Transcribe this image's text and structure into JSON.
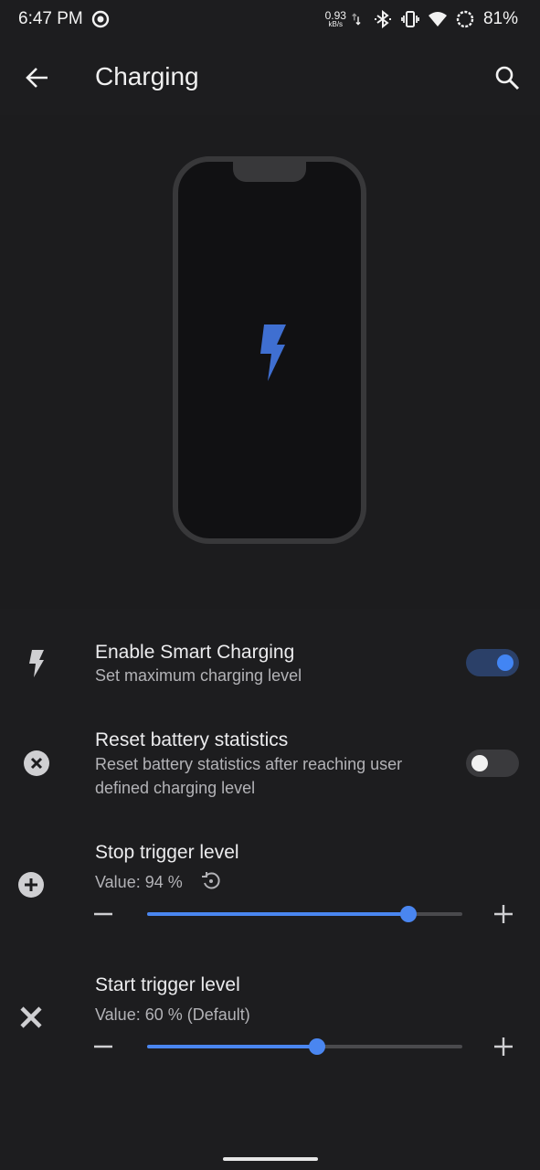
{
  "status_bar": {
    "time": "6:47 PM",
    "net_speed_value": "0.93",
    "net_speed_unit": "kB/s",
    "battery_percent": "81%",
    "icons": [
      "screen-record-icon",
      "data-transfer-icon",
      "bluetooth-icon",
      "vibrate-icon",
      "wifi-icon",
      "battery-saver-ring-icon"
    ]
  },
  "toolbar": {
    "title": "Charging",
    "back_icon": "arrow-left-icon",
    "search_icon": "search-icon"
  },
  "hero": {
    "icon": "lightning-bolt-icon",
    "accent": "#3f6fd1"
  },
  "preferences": {
    "smart_charging": {
      "icon": "flash-icon",
      "title": "Enable Smart Charging",
      "summary": "Set maximum charging level",
      "enabled": true
    },
    "reset_stats": {
      "icon": "close-circle-icon",
      "title": "Reset battery statistics",
      "summary": "Reset battery statistics after reaching user defined charging level",
      "enabled": false
    },
    "stop_trigger": {
      "icon": "plus-circle-icon",
      "title": "Stop trigger level",
      "value_text": "Value: 94 %",
      "value_percent": 83,
      "reset_icon": "restore-icon"
    },
    "start_trigger": {
      "icon": "close-icon",
      "title": "Start trigger level",
      "value_text": "Value: 60 % (Default)",
      "value_percent": 54
    }
  },
  "colors": {
    "accent": "#4285f4",
    "background": "#1d1d1f"
  }
}
